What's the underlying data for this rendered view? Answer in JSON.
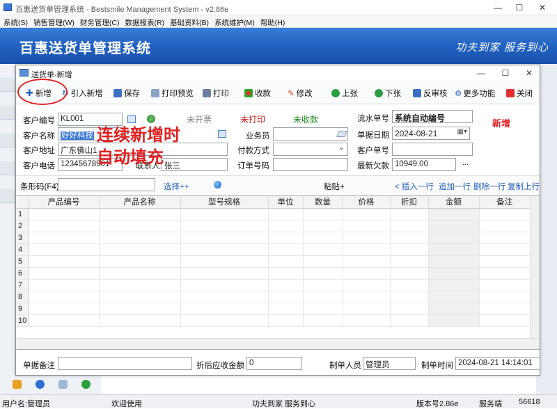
{
  "window": {
    "title": "百惠送货单管理系统 - Bestsmile Management System - v2.86e",
    "controls": [
      "—",
      "☐",
      "✕"
    ]
  },
  "menu": [
    "系统(S)",
    "销售管理(W)",
    "财务管理(C)",
    "数据报表(R)",
    "基础资料(B)",
    "系统维护(M)",
    "帮助(H)"
  ],
  "banner": {
    "title": "百惠送货单管理系统",
    "slogan": "功夫到家 服务到心"
  },
  "dialog": {
    "title": "送货单-新增",
    "controls": [
      "—",
      "☐",
      "✕"
    ],
    "toolbar": {
      "new": "新增",
      "import_new": "引入新增",
      "save": "保存",
      "print_preview": "打印预览",
      "print": "打印",
      "receipt": "收款",
      "modify": "修改",
      "prev": "上张",
      "next": "下张",
      "unaudit": "反审核",
      "more": "更多功能",
      "close": "关闭"
    },
    "form": {
      "customer_code_label": "客户编号",
      "customer_code": "KL001",
      "customer_name_label": "客户名称",
      "customer_name": "好好科技",
      "customer_addr_label": "客户地址",
      "customer_addr": "广东佛山1",
      "customer_phone_label": "客户电话",
      "customer_phone": "12345678901",
      "contact_label": "联系人",
      "contact": "张三",
      "status_invoice": "未开票",
      "status_print": "未打印",
      "status_received": "未收款",
      "salesman_label": "业务员",
      "payment_label": "付款方式",
      "order_no_label": "订单号码",
      "serial_label": "流水单号",
      "serial": "系统自动编号",
      "date_label": "单据日期",
      "date": "2024-08-21",
      "cust_order_label": "客户单号",
      "latest_owed_label": "最新欠款",
      "latest_owed": "10949.00",
      "mode_badge": "新增",
      "ellipsis": "..."
    },
    "annotation": {
      "line1": "连续新增时",
      "line2": "自动填充"
    },
    "barcode": {
      "label": "条形码(F4)",
      "select": "选择++",
      "paste": "粘贴+",
      "insert_row": "< 插入一行",
      "append_row": "追加一行",
      "delete_row": "删除一行",
      "copy_row": "复制上行"
    },
    "grid": {
      "columns": [
        "",
        "产品编号",
        "产品名称",
        "型号规格",
        "单位",
        "数量",
        "价格",
        "折扣",
        "金额",
        "备注"
      ],
      "row_numbers": [
        "1",
        "2",
        "3",
        "4",
        "5",
        "6",
        "7",
        "8",
        "9",
        "10"
      ]
    },
    "footer": {
      "remark_label": "单据备注",
      "remark": "",
      "net_label": "折后应收金额",
      "net": "0",
      "maker_label": "制单人员",
      "maker": "管理员",
      "time_label": "制单时间",
      "time": "2024-08-21 14:14:01"
    }
  },
  "status": {
    "user": "用户名:管理员",
    "welcome": "欢迎使用",
    "slogan": "功夫到家 服务到心",
    "version": "版本号2.86e",
    "side": "服务端",
    "port": "56618"
  },
  "colors": {
    "banner": "#1f5fbf",
    "accent_red": "#e02020",
    "status_green": "#1a8a1a"
  }
}
